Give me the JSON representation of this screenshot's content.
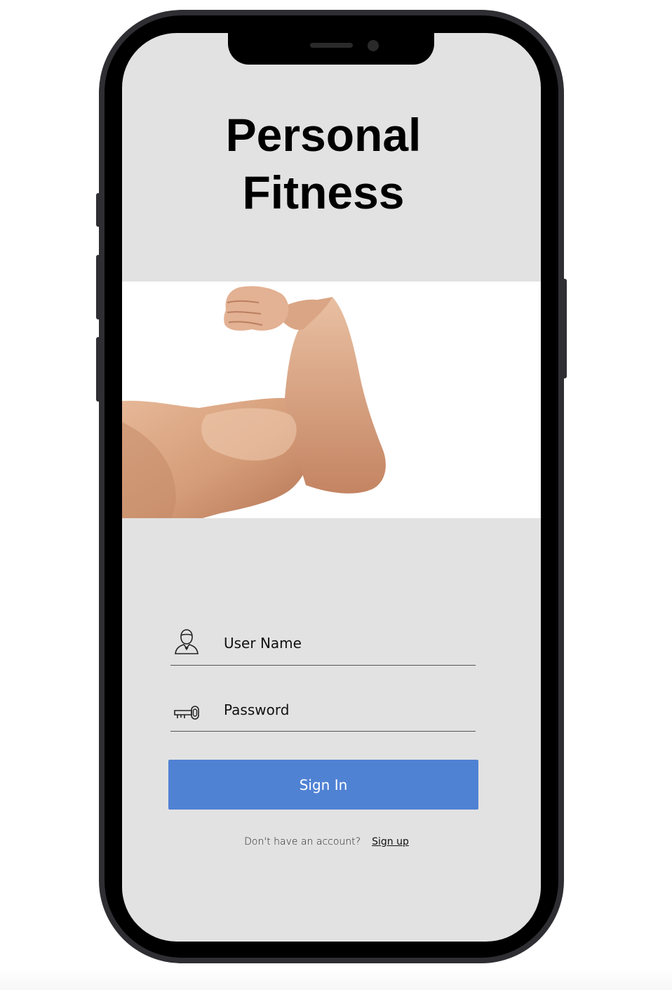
{
  "app": {
    "title_line1": "Personal",
    "title_line2": "Fitness"
  },
  "hero": {
    "image": "flexed-bicep-arm"
  },
  "login": {
    "username_placeholder": "User Name",
    "password_placeholder": "Password",
    "username_icon": "user-icon",
    "password_icon": "key-icon",
    "signin_label": "Sign In",
    "signup_prompt": "Don't have an account?",
    "signup_link": "Sign up"
  },
  "colors": {
    "screen_background": "#e2e2e2",
    "signin_button": "#5082d4",
    "phone_frame": "#2e2e33"
  }
}
